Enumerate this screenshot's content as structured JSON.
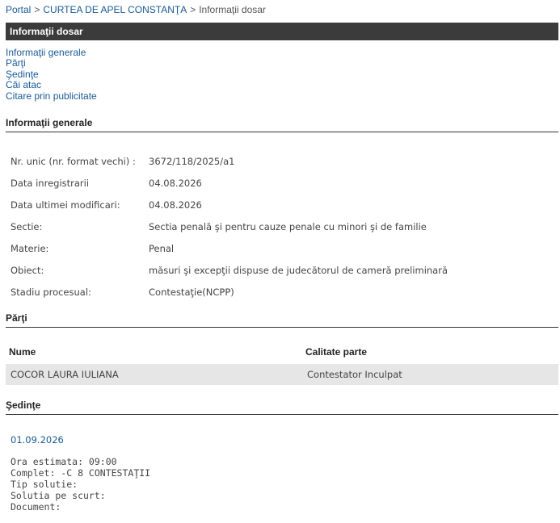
{
  "breadcrumb": {
    "items": [
      "Portal",
      "CURTEA DE APEL CONSTANŢA",
      "Informaţii dosar"
    ],
    "separator": ">"
  },
  "header": {
    "title": "Informaţii dosar"
  },
  "nav": {
    "links": [
      "Informaţii generale",
      "Părţi",
      "Şedinţe",
      "Căi atac",
      "Citare prin publicitate"
    ]
  },
  "general": {
    "title": "Informaţii generale",
    "rows": [
      {
        "label": "Nr. unic (nr. format vechi) :",
        "value": "3672/118/2025/a1"
      },
      {
        "label": "Data inregistrarii",
        "value": "04.08.2026"
      },
      {
        "label": "Data ultimei modificari:",
        "value": "04.08.2026"
      },
      {
        "label": "Sectie:",
        "value": "Sectia penală şi pentru cauze penale cu minori şi de familie"
      },
      {
        "label": "Materie:",
        "value": "Penal"
      },
      {
        "label": "Obiect:",
        "value": "măsuri şi excepţii dispuse de judecătorul de cameră preliminară"
      },
      {
        "label": "Stadiu procesual:",
        "value": "Contestaţie(NCPP)"
      }
    ]
  },
  "parties": {
    "title": "Părţi",
    "headers": {
      "name": "Nume",
      "role": "Calitate parte"
    },
    "rows": [
      {
        "name": "COCOR LAURA IULIANA",
        "role": "Contestator Inculpat"
      }
    ]
  },
  "hearings": {
    "title": "Şedinţe",
    "date": "01.09.2026",
    "details": [
      "Ora estimata: 09:00",
      "Complet: -C 8 CONTESTAŢII",
      "Tip solutie:",
      "Solutia pe scurt:",
      "Document:"
    ]
  }
}
